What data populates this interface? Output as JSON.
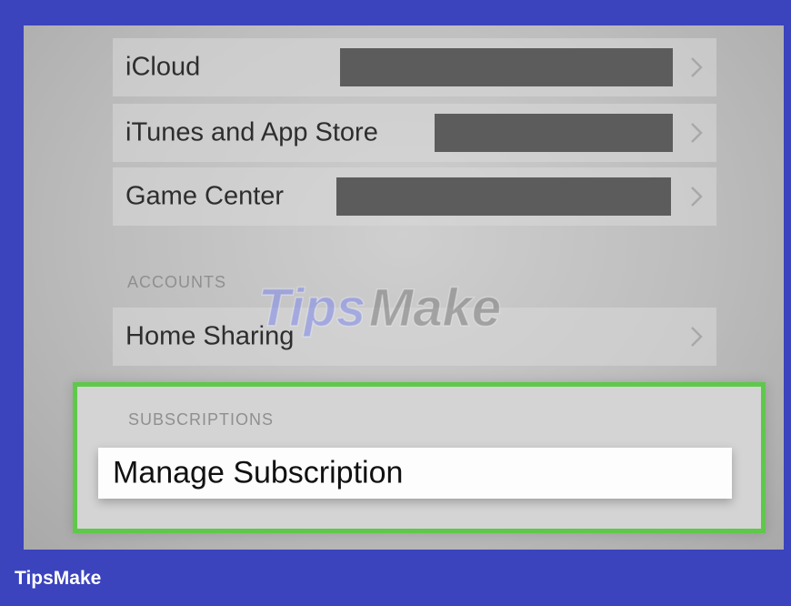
{
  "settings": {
    "rows": [
      {
        "label": "iCloud"
      },
      {
        "label": "iTunes and App Store"
      },
      {
        "label": "Game Center"
      }
    ],
    "accounts": {
      "header": "ACCOUNTS",
      "home_sharing_label": "Home Sharing"
    },
    "subscriptions": {
      "header": "SUBSCRIPTIONS",
      "manage_label": "Manage Subscription"
    }
  },
  "watermark": {
    "text": "TipsMake"
  },
  "footer": {
    "brand": "TipsMake"
  },
  "colors": {
    "frame": "#3b43bd",
    "highlight": "#5fc84b",
    "redaction": "#5c5c5c"
  },
  "icons": [
    "chevron-right-icon"
  ]
}
